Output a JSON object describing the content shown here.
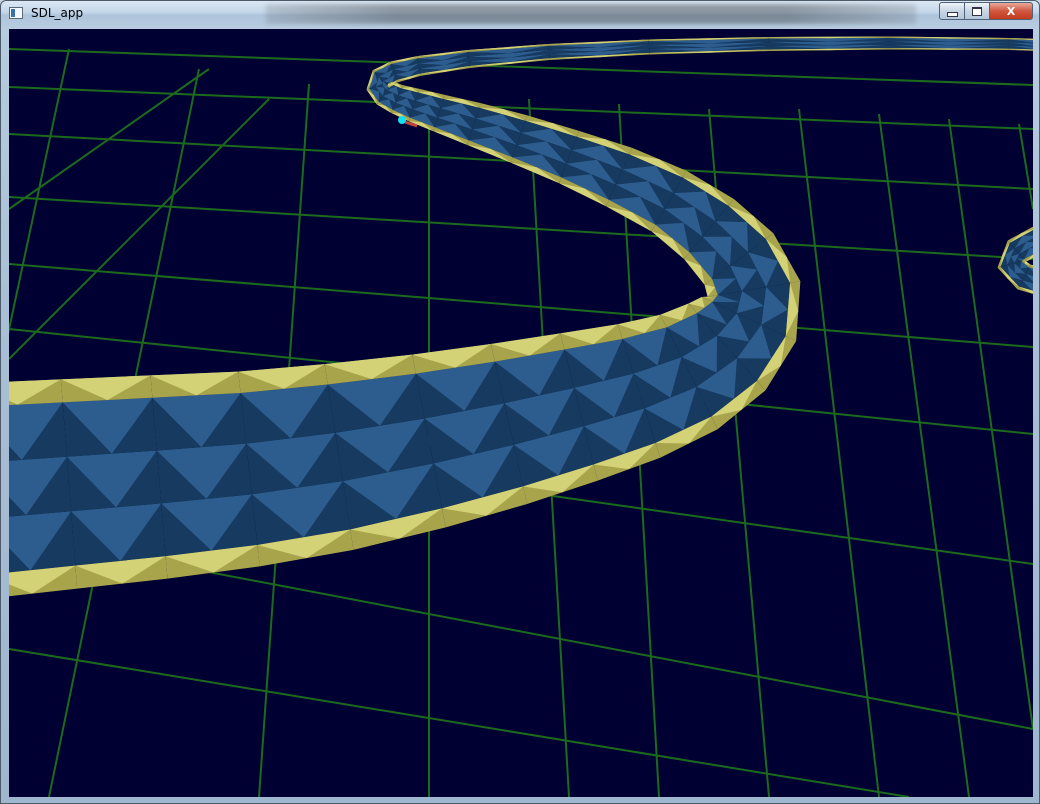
{
  "window": {
    "title": "SDL_app",
    "icon": "app-window-icon",
    "controls": {
      "minimize_icon": "minimize-icon",
      "maximize_icon": "maximize-icon",
      "close_label": "X"
    }
  },
  "scene": {
    "background_color": "#000033",
    "grid_color": "#1c6a1c",
    "track_surface_color": "#2d5d8e",
    "track_surface_dark_color": "#163a60",
    "track_edge_color": "#d4d277",
    "track_edge_dark_color": "#a8a44c",
    "marker_color": "#13e1ef",
    "marker_tail_color": "#c64040"
  }
}
